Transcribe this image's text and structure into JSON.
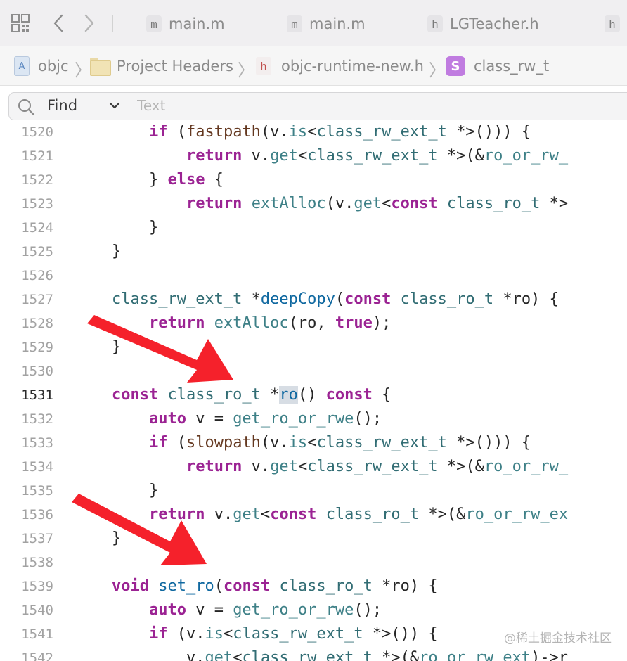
{
  "tabbar": {
    "tabs": [
      {
        "badge": "m",
        "label": "main.m"
      },
      {
        "badge": "m",
        "label": "main.m"
      },
      {
        "badge": "h",
        "label": "LGTeacher.h"
      },
      {
        "badge": "h",
        "label": ""
      }
    ]
  },
  "breadcrumb": {
    "items": [
      {
        "label": "objc",
        "icon": "project-icon"
      },
      {
        "label": "Project Headers",
        "icon": "folder-icon"
      },
      {
        "label": "objc-runtime-new.h",
        "icon": "header-file-icon",
        "badge": "h"
      },
      {
        "label": "class_rw_t",
        "icon": "struct-icon",
        "badge": "S"
      }
    ]
  },
  "findbar": {
    "mode": "Find",
    "placeholder": "Text"
  },
  "editor": {
    "current_line": "1531",
    "lines": [
      {
        "n": "1520",
        "t": [
          [
            "",
            "        "
          ],
          [
            "kw",
            "if"
          ],
          [
            "",
            " ("
          ],
          [
            "mac",
            "fastpath"
          ],
          [
            "",
            "(v."
          ],
          [
            "md",
            "is"
          ],
          [
            "",
            "<"
          ],
          [
            "ty",
            "class_rw_ext_t"
          ],
          [
            "",
            " *>())) {"
          ]
        ]
      },
      {
        "n": "1521",
        "t": [
          [
            "",
            "            "
          ],
          [
            "kw",
            "return"
          ],
          [
            "",
            " v."
          ],
          [
            "md",
            "get"
          ],
          [
            "",
            "<"
          ],
          [
            "ty",
            "class_rw_ext_t"
          ],
          [
            "",
            " *>(&"
          ],
          [
            "md",
            "ro_or_rw_"
          ]
        ]
      },
      {
        "n": "1522",
        "t": [
          [
            "",
            "        } "
          ],
          [
            "kw",
            "else"
          ],
          [
            "",
            " {"
          ]
        ]
      },
      {
        "n": "1523",
        "t": [
          [
            "",
            "            "
          ],
          [
            "kw",
            "return"
          ],
          [
            "",
            " "
          ],
          [
            "md",
            "extAlloc"
          ],
          [
            "",
            "(v."
          ],
          [
            "md",
            "get"
          ],
          [
            "",
            "<"
          ],
          [
            "kw",
            "const"
          ],
          [
            "",
            " "
          ],
          [
            "ty",
            "class_ro_t"
          ],
          [
            "",
            " *>"
          ]
        ]
      },
      {
        "n": "1524",
        "t": [
          [
            "",
            "        }"
          ]
        ]
      },
      {
        "n": "1525",
        "t": [
          [
            "",
            "    }"
          ]
        ]
      },
      {
        "n": "1526",
        "t": [
          [
            "",
            ""
          ]
        ]
      },
      {
        "n": "1527",
        "t": [
          [
            "",
            "    "
          ],
          [
            "ty",
            "class_rw_ext_t"
          ],
          [
            "",
            " *"
          ],
          [
            "decl",
            "deepCopy"
          ],
          [
            "",
            "("
          ],
          [
            "kw",
            "const"
          ],
          [
            "",
            " "
          ],
          [
            "ty",
            "class_ro_t"
          ],
          [
            "",
            " *ro) {"
          ]
        ]
      },
      {
        "n": "1528",
        "t": [
          [
            "",
            "        "
          ],
          [
            "kw",
            "return"
          ],
          [
            "",
            " "
          ],
          [
            "md",
            "extAlloc"
          ],
          [
            "",
            "(ro, "
          ],
          [
            "kw",
            "true"
          ],
          [
            "",
            ");"
          ]
        ]
      },
      {
        "n": "1529",
        "t": [
          [
            "",
            "    }"
          ]
        ]
      },
      {
        "n": "1530",
        "t": [
          [
            "",
            ""
          ]
        ]
      },
      {
        "n": "1531",
        "t": [
          [
            "",
            "    "
          ],
          [
            "kw",
            "const"
          ],
          [
            "",
            " "
          ],
          [
            "ty",
            "class_ro_t"
          ],
          [
            "",
            " *"
          ],
          [
            "hl",
            "ro"
          ],
          [
            "",
            "() "
          ],
          [
            "kw",
            "const"
          ],
          [
            "",
            " {"
          ]
        ]
      },
      {
        "n": "1532",
        "t": [
          [
            "",
            "        "
          ],
          [
            "kw",
            "auto"
          ],
          [
            "",
            " v = "
          ],
          [
            "md",
            "get_ro_or_rwe"
          ],
          [
            "",
            "();"
          ]
        ]
      },
      {
        "n": "1533",
        "t": [
          [
            "",
            "        "
          ],
          [
            "kw",
            "if"
          ],
          [
            "",
            " ("
          ],
          [
            "mac",
            "slowpath"
          ],
          [
            "",
            "(v."
          ],
          [
            "md",
            "is"
          ],
          [
            "",
            "<"
          ],
          [
            "ty",
            "class_rw_ext_t"
          ],
          [
            "",
            " *>())) {"
          ]
        ]
      },
      {
        "n": "1534",
        "t": [
          [
            "",
            "            "
          ],
          [
            "kw",
            "return"
          ],
          [
            "",
            " v."
          ],
          [
            "md",
            "get"
          ],
          [
            "",
            "<"
          ],
          [
            "ty",
            "class_rw_ext_t"
          ],
          [
            "",
            " *>(&"
          ],
          [
            "md",
            "ro_or_rw_"
          ]
        ]
      },
      {
        "n": "1535",
        "t": [
          [
            "",
            "        }"
          ]
        ]
      },
      {
        "n": "1536",
        "t": [
          [
            "",
            "        "
          ],
          [
            "kw",
            "return"
          ],
          [
            "",
            " v."
          ],
          [
            "md",
            "get"
          ],
          [
            "",
            "<"
          ],
          [
            "kw",
            "const"
          ],
          [
            "",
            " "
          ],
          [
            "ty",
            "class_ro_t"
          ],
          [
            "",
            " *>(&"
          ],
          [
            "md",
            "ro_or_rw_ex"
          ]
        ]
      },
      {
        "n": "1537",
        "t": [
          [
            "",
            "    }"
          ]
        ]
      },
      {
        "n": "1538",
        "t": [
          [
            "",
            ""
          ]
        ]
      },
      {
        "n": "1539",
        "t": [
          [
            "",
            "    "
          ],
          [
            "kw",
            "void"
          ],
          [
            "",
            " "
          ],
          [
            "decl",
            "set_ro"
          ],
          [
            "",
            "("
          ],
          [
            "kw",
            "const"
          ],
          [
            "",
            " "
          ],
          [
            "ty",
            "class_ro_t"
          ],
          [
            "",
            " *ro) {"
          ]
        ]
      },
      {
        "n": "1540",
        "t": [
          [
            "",
            "        "
          ],
          [
            "kw",
            "auto"
          ],
          [
            "",
            " v = "
          ],
          [
            "md",
            "get_ro_or_rwe"
          ],
          [
            "",
            "();"
          ]
        ]
      },
      {
        "n": "1541",
        "t": [
          [
            "",
            "        "
          ],
          [
            "kw",
            "if"
          ],
          [
            "",
            " (v."
          ],
          [
            "md",
            "is"
          ],
          [
            "",
            "<"
          ],
          [
            "ty",
            "class_rw_ext_t"
          ],
          [
            "",
            " *>()) {"
          ]
        ]
      },
      {
        "n": "1542",
        "t": [
          [
            "",
            "            v."
          ],
          [
            "md",
            "get"
          ],
          [
            "",
            "<"
          ],
          [
            "ty",
            "class_rw_ext_t"
          ],
          [
            "",
            " *>(&"
          ],
          [
            "md",
            "ro_or_rw_ext"
          ],
          [
            "",
            ")->r"
          ]
        ]
      }
    ]
  },
  "watermark": "@稀土掘金技术社区",
  "colors": {
    "keyword": "#9b2393",
    "type": "#326d74",
    "declaration": "#0f68a0",
    "annotation_arrow": "#f5212b"
  }
}
